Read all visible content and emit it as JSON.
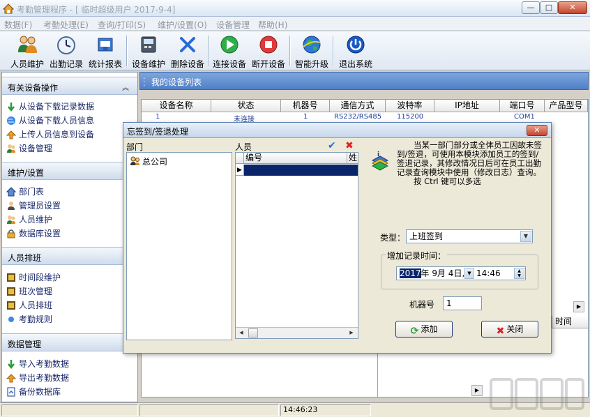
{
  "window": {
    "title": "考勤管理程序 - [ 临时超级用户 2017-9-4]",
    "min_label": "—",
    "max_label": "□",
    "close_label": "✕"
  },
  "menu": [
    "数据(F)",
    "考勤处理(E)",
    "查询/打印(S)",
    "维护/设置(O)",
    "设备管理",
    "帮助(H)"
  ],
  "toolbar": [
    {
      "label": "人员维护",
      "icon": "users-icon"
    },
    {
      "label": "出勤记录",
      "icon": "clock-icon"
    },
    {
      "label": "统计报表",
      "icon": "report-icon"
    },
    {
      "label": "设备维护",
      "icon": "device-icon"
    },
    {
      "label": "删除设备",
      "icon": "delete-icon"
    },
    {
      "label": "连接设备",
      "icon": "connect-icon"
    },
    {
      "label": "断开设备",
      "icon": "disconnect-icon"
    },
    {
      "label": "智能升级",
      "icon": "globe-icon"
    },
    {
      "label": "退出系统",
      "icon": "power-icon"
    }
  ],
  "sidebar": {
    "sections": [
      {
        "title": "有关设备操作",
        "items": [
          "从设备下载记录数据",
          "从设备下载人员信息",
          "上传人员信息到设备",
          "设备管理"
        ]
      },
      {
        "title": "维护/设置",
        "items": [
          "部门表",
          "管理员设置",
          "人员维护",
          "数据库设置"
        ]
      },
      {
        "title": "人员排班",
        "items": [
          "时间段维护",
          "班次管理",
          "人员排班",
          "考勤规则"
        ]
      },
      {
        "title": "数据管理",
        "items": [
          "导入考勤数据",
          "导出考勤数据",
          "备份数据库"
        ]
      }
    ],
    "collapse_glyph": "︽"
  },
  "main": {
    "title": "我的设备列表",
    "columns": [
      "设备名称",
      "状态",
      "机器号",
      "通信方式",
      "波特率",
      "IP地址",
      "端口号",
      "产品型号"
    ],
    "row": {
      "name": "1",
      "status": "未连接",
      "machine": "1",
      "comm": "RS232/RS485",
      "baud": "115200",
      "port": "COM1"
    },
    "lower_time_header": "时间"
  },
  "status": {
    "time": "14:46:23"
  },
  "dialog": {
    "title": "忘签到/签退处理",
    "close_label": "✕",
    "dept_label": "部门",
    "dept_items": [
      "总公司"
    ],
    "person_label": "人员",
    "person_columns": [
      "编号",
      "姓"
    ],
    "info_line1": "当某一部门部分或全体员工因故未签到/签退，可使用本模块添加员工的签到/签退记录，其修改情况日后可在员工出勤记录查询模块中使用（修改日志）查询。",
    "info_line2": "按 Ctrl 键可以多选",
    "type_label": "类型：",
    "type_value": "上班签到",
    "time_group_label": "增加记录时间：",
    "date_year": "2017",
    "date_rest": "年  9月  4日,",
    "time_value": "14:46",
    "machine_label": "机器号",
    "machine_value": "1",
    "add_label": "添加",
    "close_btn_label": "关闭"
  },
  "colors": {
    "accent": "#4f7fc6",
    "selection": "#0a246a"
  }
}
